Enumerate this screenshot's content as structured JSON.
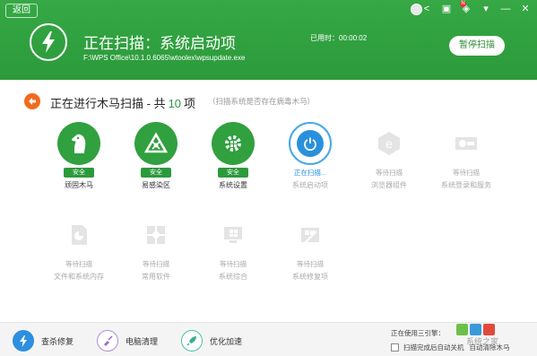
{
  "header": {
    "back_label": "返回",
    "title": "正在扫描：系统启动项",
    "path": "F:\\WPS Office\\10.1.0.6065\\wtoolex\\wpsupdate.exe",
    "elapsed_label": "已用时：00:00:02",
    "pause_label": "暂停扫描",
    "notification_badge": "N",
    "window_controls": [
      "share-icon",
      "gift-icon",
      "skin-icon",
      "menu-icon",
      "minimize-icon",
      "close-icon"
    ]
  },
  "scan": {
    "prefix": "正在进行木马扫描 - 共",
    "count": "10",
    "suffix": "项",
    "sub": "（扫描系统是否存在病毒木马）"
  },
  "tiles": [
    {
      "name": "顽固木马",
      "status": "安全",
      "state": "done",
      "icon": "horse-icon"
    },
    {
      "name": "易感染区",
      "status": "安全",
      "state": "done",
      "icon": "network-icon"
    },
    {
      "name": "系统设置",
      "status": "安全",
      "state": "done",
      "icon": "gear-icon"
    },
    {
      "name": "系统启动项",
      "status": "正在扫描...",
      "state": "active",
      "icon": "power-icon"
    },
    {
      "name": "浏览器组件",
      "status": "等待扫描",
      "state": "wait",
      "icon": "browser-icon"
    },
    {
      "name": "系统登录和服务",
      "status": "等待扫描",
      "state": "wait",
      "icon": "login-service-icon"
    },
    {
      "name": "文件和系统内存",
      "status": "等待扫描",
      "state": "wait",
      "icon": "file-memory-icon"
    },
    {
      "name": "常用软件",
      "status": "等待扫描",
      "state": "wait",
      "icon": "software-icon"
    },
    {
      "name": "系统综合",
      "status": "等待扫描",
      "state": "wait",
      "icon": "system-icon"
    },
    {
      "name": "系统修复项",
      "status": "等待扫描",
      "state": "wait",
      "icon": "repair-icon"
    }
  ],
  "footer": {
    "tabs": [
      {
        "label": "查杀修复",
        "icon": "bolt-icon",
        "selected": true
      },
      {
        "label": "电脑清理",
        "icon": "broom-icon",
        "selected": false
      },
      {
        "label": "优化加速",
        "icon": "rocket-icon",
        "selected": false
      }
    ],
    "engine_label": "正在使用三引擎：",
    "shutdown_label": "扫描完成后自动关机",
    "auto_label": "自动清除木马",
    "watermark": "系统之家"
  },
  "colors": {
    "header_green": "#2b9a3b",
    "safe_green": "#31a03f",
    "active_blue": "#2991dc",
    "scan_orange": "#f26b1d"
  }
}
